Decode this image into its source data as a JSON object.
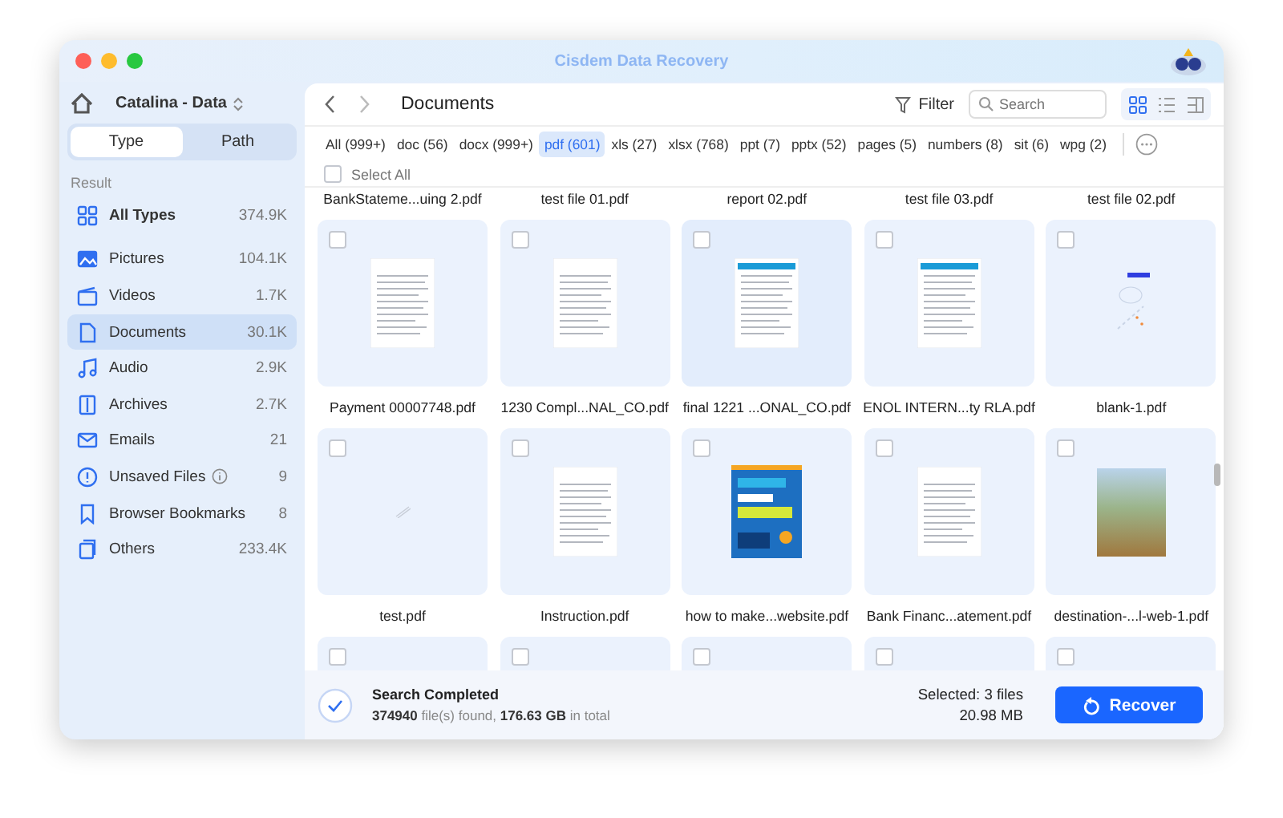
{
  "window": {
    "title": "Cisdem Data Recovery"
  },
  "sidebar": {
    "drive": "Catalina - Data",
    "tabs": [
      {
        "label": "Type",
        "selected": true
      },
      {
        "label": "Path",
        "selected": false
      }
    ],
    "section_label": "Result",
    "items": [
      {
        "kind": "all",
        "label": "All Types",
        "count": "374.9K",
        "selected": false,
        "info": false
      },
      {
        "kind": "pictures",
        "label": "Pictures",
        "count": "104.1K",
        "selected": false,
        "info": false
      },
      {
        "kind": "videos",
        "label": "Videos",
        "count": "1.7K",
        "selected": false,
        "info": false
      },
      {
        "kind": "documents",
        "label": "Documents",
        "count": "30.1K",
        "selected": true,
        "info": false
      },
      {
        "kind": "audio",
        "label": "Audio",
        "count": "2.9K",
        "selected": false,
        "info": false
      },
      {
        "kind": "archives",
        "label": "Archives",
        "count": "2.7K",
        "selected": false,
        "info": false
      },
      {
        "kind": "emails",
        "label": "Emails",
        "count": "21",
        "selected": false,
        "info": false
      },
      {
        "kind": "unsaved",
        "label": "Unsaved Files",
        "count": "9",
        "selected": false,
        "info": true
      },
      {
        "kind": "bookmarks",
        "label": "Browser Bookmarks",
        "count": "8",
        "selected": false,
        "info": false
      },
      {
        "kind": "others",
        "label": "Others",
        "count": "233.4K",
        "selected": false,
        "info": false
      }
    ]
  },
  "toolbar": {
    "title": "Documents",
    "filter": "Filter",
    "search": {
      "placeholder": "Search"
    },
    "views": [
      {
        "kind": "grid",
        "selected": true
      },
      {
        "kind": "list",
        "selected": false
      },
      {
        "kind": "columns",
        "selected": false
      }
    ]
  },
  "type_tabs": [
    {
      "label": "All (999+)",
      "selected": false
    },
    {
      "label": "doc (56)",
      "selected": false
    },
    {
      "label": "docx (999+)",
      "selected": false
    },
    {
      "label": "pdf (601)",
      "selected": true
    },
    {
      "label": "xls (27)",
      "selected": false
    },
    {
      "label": "xlsx (768)",
      "selected": false
    },
    {
      "label": "ppt (7)",
      "selected": false
    },
    {
      "label": "pptx (52)",
      "selected": false
    },
    {
      "label": "pages (5)",
      "selected": false
    },
    {
      "label": "numbers (8)",
      "selected": false
    },
    {
      "label": "sit (6)",
      "selected": false
    },
    {
      "label": "wpg (2)",
      "selected": false
    }
  ],
  "select_all": {
    "label": "Select All",
    "checked": false
  },
  "previous_row_names": [
    "BankStateme...uing 2.pdf",
    "test file 01.pdf",
    "report 02.pdf",
    "test file 03.pdf",
    "test file 02.pdf"
  ],
  "files": [
    {
      "name": "Payment 00007748.pdf",
      "kind": "page",
      "checked": false
    },
    {
      "name": "1230 Compl...NAL_CO.pdf",
      "kind": "page",
      "checked": false
    },
    {
      "name": "final 1221 ...ONAL_CO.pdf",
      "kind": "banner",
      "checked": false
    },
    {
      "name": "ENOL INTERN...ty RLA.pdf",
      "kind": "banner",
      "checked": false
    },
    {
      "name": "blank-1.pdf",
      "kind": "sketch",
      "checked": false
    },
    {
      "name": "test.pdf",
      "kind": "blank",
      "checked": false
    },
    {
      "name": "Instruction.pdf",
      "kind": "page",
      "checked": false
    },
    {
      "name": "how to make...website.pdf",
      "kind": "cover",
      "checked": false
    },
    {
      "name": "Bank Financ...atement.pdf",
      "kind": "page",
      "checked": false
    },
    {
      "name": "destination-...l-web-1.pdf",
      "kind": "photo",
      "checked": false
    }
  ],
  "next_row_cards": [
    {
      "checked": false
    },
    {
      "checked": false
    },
    {
      "checked": false
    },
    {
      "checked": false
    },
    {
      "checked": false
    }
  ],
  "status": {
    "title": "Search Completed",
    "summary": "**374940** file(s) found, **176.63 GB** in total",
    "selected": "Selected: 3 files",
    "size": "20.98 MB",
    "button": "Recover"
  }
}
